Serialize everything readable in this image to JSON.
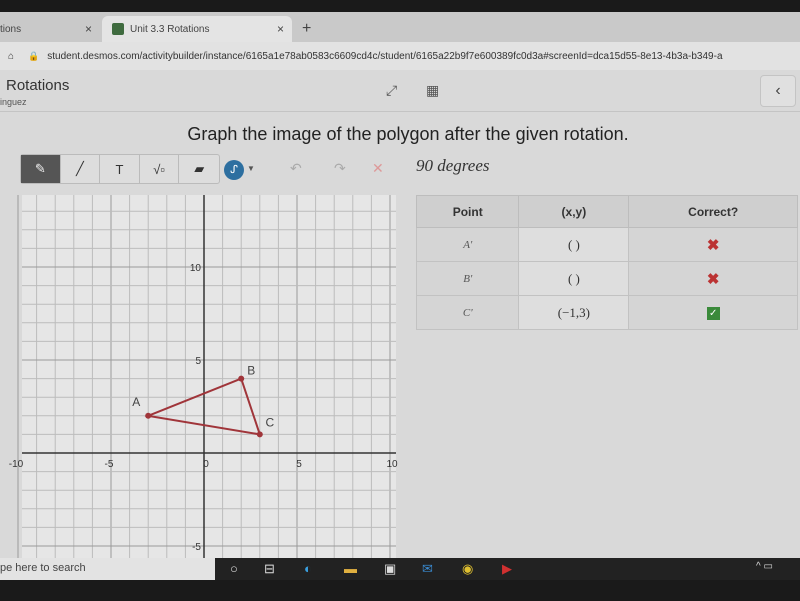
{
  "browser": {
    "tabs": [
      {
        "label": "tions"
      },
      {
        "label": "Unit 3.3 Rotations"
      }
    ],
    "new_tab": "+",
    "close": "×",
    "url": "student.desmos.com/activitybuilder/instance/6165a1e78ab0583c6609cd4c/student/6165a22b9f7e600389fc0d3a#screenId=dca15d55-8e13-4b3a-b349-a"
  },
  "header": {
    "title": "Rotations",
    "subtitle": "inguez",
    "back": "‹"
  },
  "prompt": "Graph the image of the polygon after the given rotation.",
  "rotation_label": "90 degrees",
  "toolbar": {
    "tools": [
      "pencil-icon",
      "line-icon",
      "text-icon",
      "math-icon",
      "eraser-icon"
    ],
    "text_tool": "T",
    "math_tool": "√▫",
    "color": "#2d6fa0"
  },
  "graph": {
    "xlim": [
      -10,
      10
    ],
    "ylim": [
      -10,
      10
    ],
    "ticks": [
      {
        "v": -10,
        "l": "-10"
      },
      {
        "v": -5,
        "l": "-5"
      },
      {
        "v": 0,
        "l": "0"
      },
      {
        "v": 5,
        "l": "5"
      },
      {
        "v": 10,
        "l": "10"
      }
    ],
    "yticks": [
      {
        "v": 10,
        "l": "10"
      },
      {
        "v": 5,
        "l": "5"
      },
      {
        "v": -5,
        "l": "-5"
      }
    ],
    "polygon_color": "#a0353a",
    "points": [
      {
        "label": "A",
        "x": -3,
        "y": 2
      },
      {
        "label": "B",
        "x": 2,
        "y": 4
      },
      {
        "label": "C",
        "x": 3,
        "y": 1
      }
    ]
  },
  "table": {
    "headers": [
      "Point",
      "(x,y)",
      "Correct?"
    ],
    "rows": [
      {
        "point": "A'",
        "value": "( )",
        "correct": false
      },
      {
        "point": "B'",
        "value": "( )",
        "correct": false
      },
      {
        "point": "C'",
        "value": "(−1,3)",
        "correct": true
      }
    ]
  },
  "taskbar": {
    "search": "pe here to search"
  }
}
